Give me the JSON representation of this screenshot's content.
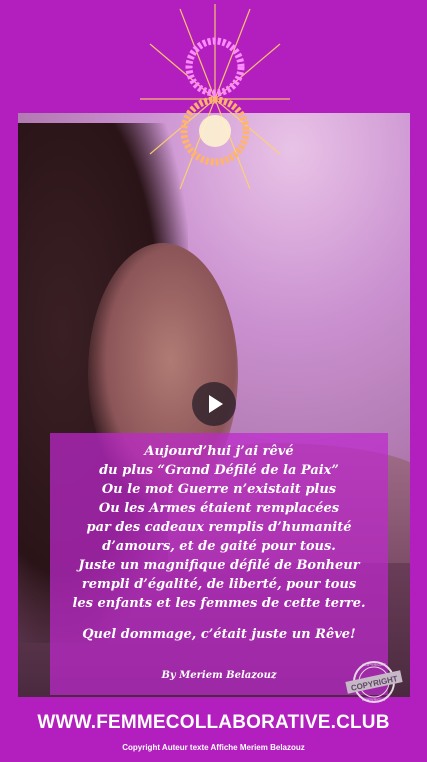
{
  "poem": {
    "lines": [
      "Aujourd’hui j’ai rêvé",
      "du plus “Grand Défilé de la Paix”",
      "Ou le mot Guerre n’existait plus",
      "Ou les Armes étaient remplacées",
      "par des cadeaux remplis d’humanité",
      "d’amours, et de gaité pour tous.",
      "Juste un magnifique défilé de Bonheur",
      "rempli d’égalité, de liberté, pour tous",
      "les enfants et les femmes de cette terre."
    ],
    "closing": "Quel dommage, c’était juste un Rêve!",
    "signature": "By Meriem Belazouz"
  },
  "stamp": {
    "top": "COPYRIGHT",
    "label": "COPYRIGHT",
    "bottom": "COPYRIGHT"
  },
  "footer": {
    "site": "WWW.FEMMECOLLABORATIVE.CLUB",
    "copyright": "Copyright Auteur texte Affiche Meriem Belazouz"
  },
  "colors": {
    "background": "#b21fbe",
    "text": "#ffffff"
  },
  "icons": {
    "play": "play-icon",
    "logo": "infinity-sun-logo"
  }
}
